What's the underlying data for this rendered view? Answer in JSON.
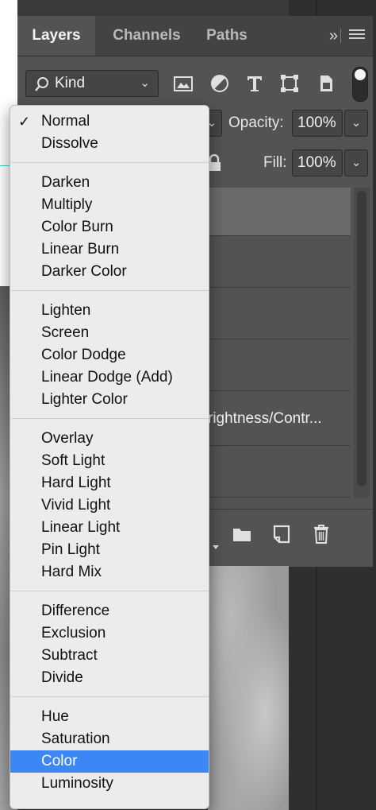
{
  "tabs": [
    {
      "label": "Layers",
      "active": true
    },
    {
      "label": "Channels",
      "active": false
    },
    {
      "label": "Paths",
      "active": false
    }
  ],
  "tab_more_label": "»",
  "filter": {
    "kind_label": "Kind",
    "icons": [
      "image-filter-icon",
      "adjustment-filter-icon",
      "type-filter-icon",
      "shape-filter-icon",
      "smart-object-filter-icon"
    ]
  },
  "opacity": {
    "label": "Opacity:",
    "value": "100%"
  },
  "fill": {
    "label": "Fill:",
    "value": "100%"
  },
  "layers": [
    {
      "name": ""
    },
    {
      "name": ""
    },
    {
      "name": ""
    },
    {
      "name": ""
    },
    {
      "name": "rightness/Contr..."
    },
    {
      "name": ""
    }
  ],
  "blend_modes": {
    "selected": "Color",
    "checked": "Normal",
    "groups": [
      [
        "Normal",
        "Dissolve"
      ],
      [
        "Darken",
        "Multiply",
        "Color Burn",
        "Linear Burn",
        "Darker Color"
      ],
      [
        "Lighten",
        "Screen",
        "Color Dodge",
        "Linear Dodge (Add)",
        "Lighter Color"
      ],
      [
        "Overlay",
        "Soft Light",
        "Hard Light",
        "Vivid Light",
        "Linear Light",
        "Pin Light",
        "Hard Mix"
      ],
      [
        "Difference",
        "Exclusion",
        "Subtract",
        "Divide"
      ],
      [
        "Hue",
        "Saturation",
        "Color",
        "Luminosity"
      ]
    ]
  },
  "colors": {
    "accent": "#3d87f5",
    "panel": "#535353",
    "menu": "#ececec"
  }
}
